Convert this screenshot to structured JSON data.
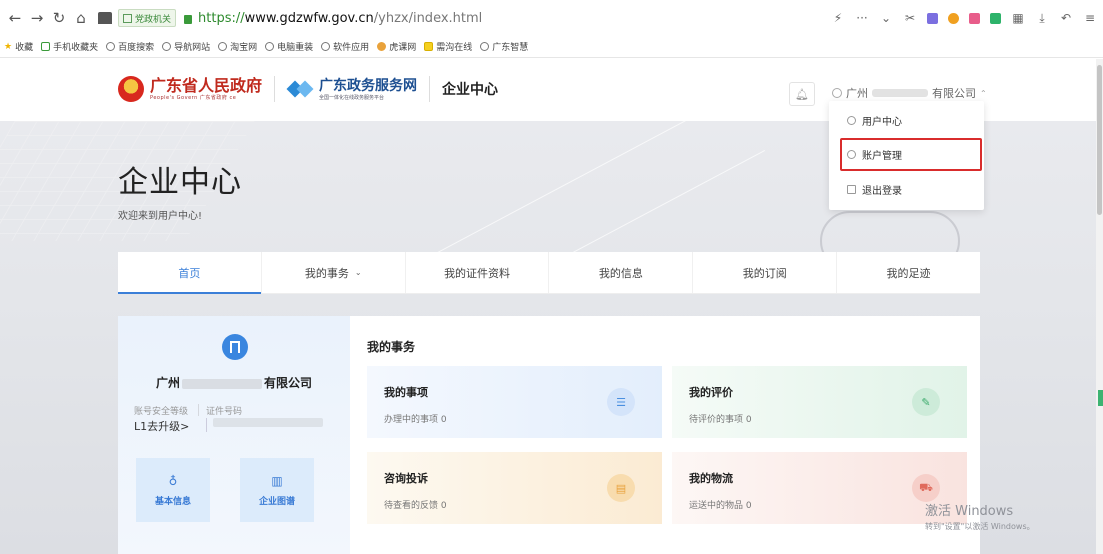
{
  "browser": {
    "chip_label": "党政机关",
    "url_proto": "https://",
    "url_host": "www.gdzwfw.gov.cn",
    "url_path": "/yhzx/index.html",
    "bookmarks": [
      "收藏",
      "手机收藏夹",
      "百度搜索",
      "导航网站",
      "淘宝网",
      "电脑重装",
      "软件应用",
      "虎课网",
      "需沟在线",
      "广东智慧"
    ]
  },
  "header": {
    "gov_name": "广东省人民政府",
    "gov_sub": "People's Govern  广东省政府  ce",
    "service_name": "广东政务服务网",
    "service_sub": "全国一体化在线政务服务平台",
    "title": "企业中心",
    "user_prefix": "广州",
    "user_suffix": "有限公司"
  },
  "dropdown": {
    "items": [
      {
        "label": "用户中心",
        "icon": "user-icon"
      },
      {
        "label": "账户管理",
        "icon": "settings-icon"
      },
      {
        "label": "退出登录",
        "icon": "logout-icon"
      }
    ]
  },
  "hero": {
    "title": "企业中心",
    "welcome": "欢迎来到用户中心!"
  },
  "tabs": [
    {
      "label": "首页",
      "active": true
    },
    {
      "label": "我的事务",
      "has_dropdown": true
    },
    {
      "label": "我的证件资料"
    },
    {
      "label": "我的信息"
    },
    {
      "label": "我的订阅"
    },
    {
      "label": "我的足迹"
    }
  ],
  "profile": {
    "name_prefix": "广州",
    "name_suffix": "有限公司",
    "security_label": "账号安全等级",
    "security_value": "L1去升级>",
    "id_label": "证件号码",
    "tiles": [
      {
        "label": "基本信息",
        "icon": "ribbon-icon"
      },
      {
        "label": "企业图谱",
        "icon": "graph-icon"
      }
    ]
  },
  "affairs": {
    "title": "我的事务",
    "cards": [
      {
        "title": "我的事项",
        "subtitle": "办理中的事项 0",
        "icon": "list-icon",
        "color": "#4a8fe0"
      },
      {
        "title": "我的评价",
        "subtitle": "待评价的事项 0",
        "icon": "edit-icon",
        "color": "#3cab6c"
      },
      {
        "title": "咨询投诉",
        "subtitle": "待查看的反馈 0",
        "icon": "message-icon",
        "color": "#e8a23c"
      },
      {
        "title": "我的物流",
        "subtitle": "运送中的物品 0",
        "icon": "truck-icon",
        "color": "#e06a5c"
      }
    ]
  },
  "watermark": {
    "line1": "激活 Windows",
    "line2": "转到\"设置\"以激活 Windows。"
  }
}
